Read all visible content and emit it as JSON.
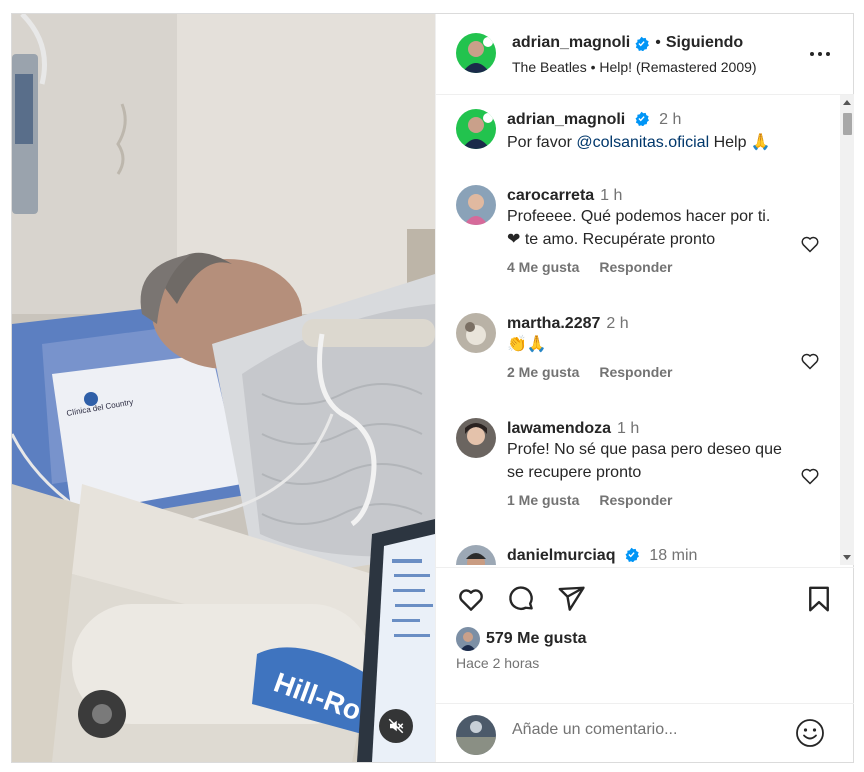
{
  "post": {
    "username": "adrian_magnoli",
    "separator": "•",
    "follow_status": "Siguiendo",
    "audio": "The Beatles • Help! (Remastered 2009)",
    "caption_time": "2 h",
    "caption_prefix": "Por favor",
    "caption_mention": "@colsanitas.oficial",
    "caption_suffix": "Help 🙏"
  },
  "media": {
    "bed_brand": "Hill-Ro",
    "pillow_label": "Clínica del Country"
  },
  "comments": [
    {
      "user": "carocarreta",
      "time": "1 h",
      "text": "Profeeee. Qué podemos hacer por ti. ❤ te amo. Recupérate pronto",
      "likes": "4 Me gusta",
      "reply": "Responder"
    },
    {
      "user": "martha.2287",
      "time": "2 h",
      "text": "👏🙏",
      "likes": "2 Me gusta",
      "reply": "Responder"
    },
    {
      "user": "lawamendoza",
      "time": "1 h",
      "text": "Profe! No sé que pasa pero deseo que se recupere pronto",
      "likes": "1 Me gusta",
      "reply": "Responder"
    },
    {
      "user": "danielmurciaq",
      "time": "18 min"
    }
  ],
  "footer": {
    "likes": "579 Me gusta",
    "time_ago": "Hace 2 horas",
    "comment_placeholder": "Añade un comentario..."
  },
  "colors": {
    "verified": "#0095f6",
    "link": "#00376b",
    "secondary_text": "#737373",
    "border": "#dbdbdb"
  },
  "icons": [
    "verified-icon",
    "more-options-icon",
    "heart-icon",
    "comment-icon",
    "share-icon",
    "bookmark-icon",
    "emoji-icon",
    "mute-icon"
  ]
}
